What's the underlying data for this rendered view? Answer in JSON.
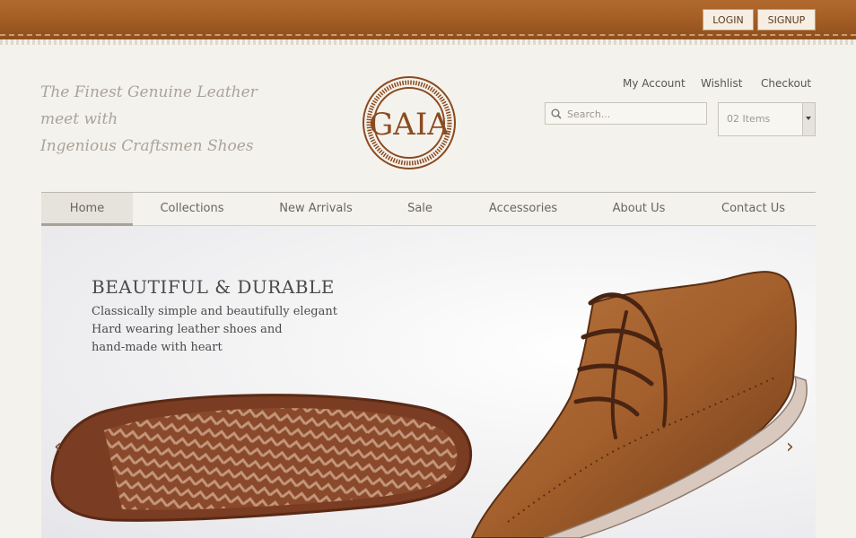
{
  "auth": {
    "login_label": "LOGIN",
    "signup_label": "SIGNUP"
  },
  "header": {
    "tagline_line1": "The Finest Genuine Leather meet with",
    "tagline_line2": "Ingenious Craftsmen Shoes",
    "logo_text": "GAIA"
  },
  "account_links": {
    "my_account": "My Account",
    "wishlist": "Wishlist",
    "checkout": "Checkout"
  },
  "search": {
    "placeholder": "Search..."
  },
  "cart": {
    "selected": "02 Items"
  },
  "nav": {
    "items": [
      {
        "label": "Home"
      },
      {
        "label": "Collections"
      },
      {
        "label": "New Arrivals"
      },
      {
        "label": "Sale"
      },
      {
        "label": "Accessories"
      },
      {
        "label": "About Us"
      },
      {
        "label": "Contact Us"
      }
    ],
    "active": "Home"
  },
  "hero": {
    "title": "BEAUTIFUL & DURABLE",
    "line1": "Classically simple and beautifully elegant",
    "line2": "Hard wearing leather shoes and",
    "line3": "hand-made with heart"
  },
  "colors": {
    "leather": "#a55f26",
    "logo": "#8b4a20",
    "background": "#f4f2ec"
  },
  "icons": {
    "search": "search-icon",
    "prev": "chevron-left-icon",
    "next": "chevron-right-icon"
  }
}
